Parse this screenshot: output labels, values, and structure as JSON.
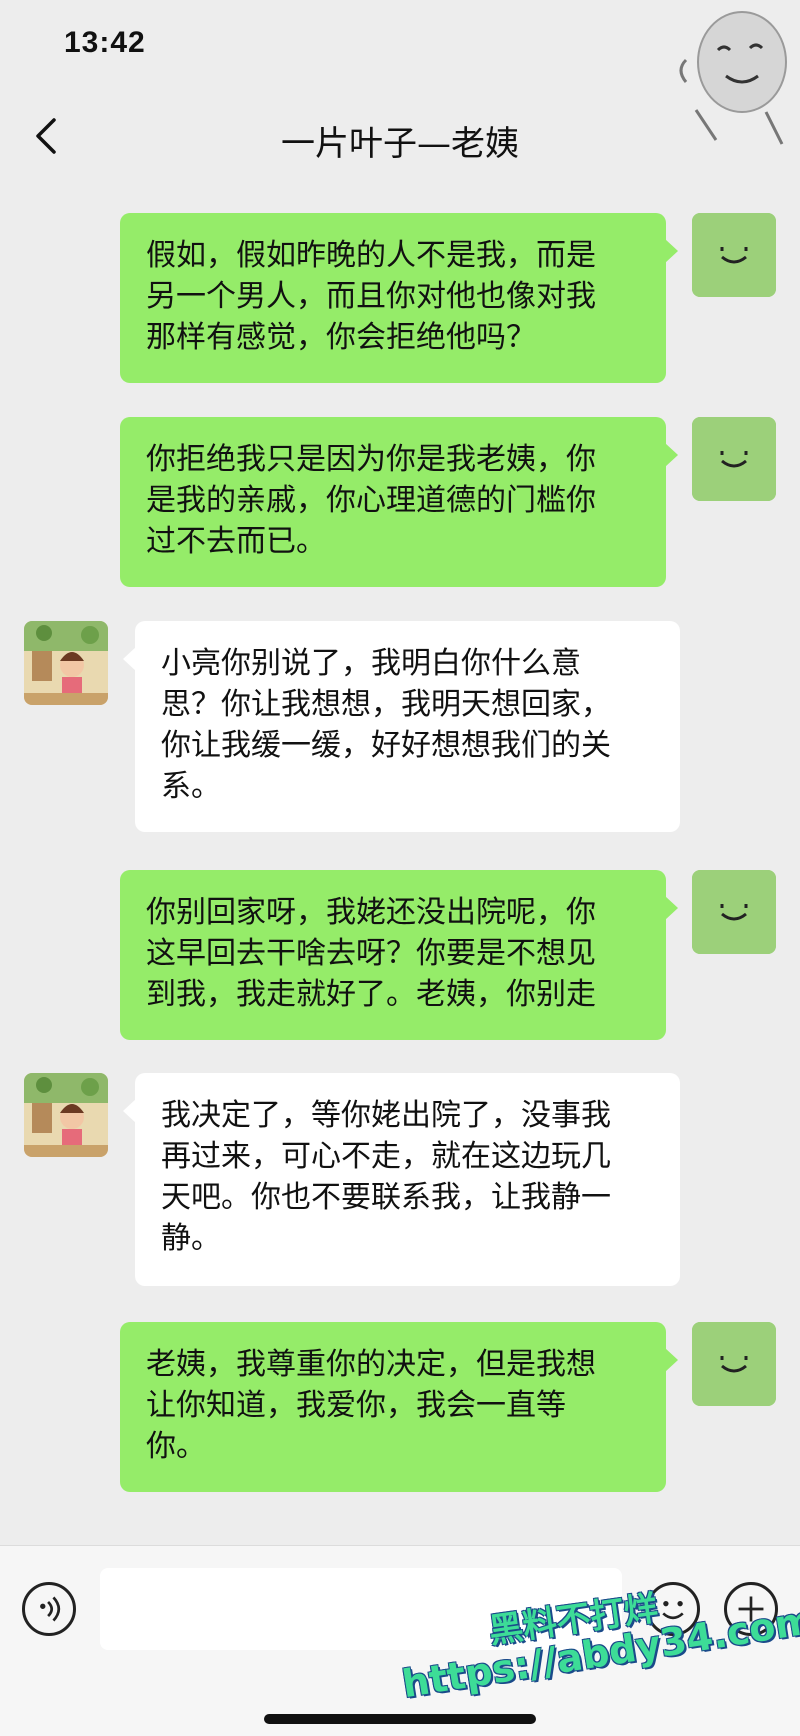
{
  "status_bar": {
    "time": "13:42"
  },
  "nav": {
    "title": "一片叶子—老姨"
  },
  "colors": {
    "me_bubble": "#95ec69",
    "other_bubble": "#ffffff",
    "background": "#ededed"
  },
  "messages": [
    {
      "sender": "me",
      "lines": [
        "假如，假如昨晚的人不是我，而是",
        "另一个男人，而且你对他也像对我",
        "那样有感觉，你会拒绝他吗？"
      ]
    },
    {
      "sender": "me",
      "lines": [
        "你拒绝我只是因为你是我老姨，你",
        "是我的亲戚，你心理道德的门槛你",
        "过不去而已。"
      ]
    },
    {
      "sender": "other",
      "lines": [
        "小亮你别说了，我明白你什么意",
        "思？你让我想想，我明天想回家，",
        "你让我缓一缓，好好想想我们的关",
        "系。"
      ]
    },
    {
      "sender": "me",
      "lines": [
        "你别回家呀，我姥还没出院呢，你",
        "这早回去干啥去呀？你要是不想见",
        "到我，我走就好了。老姨，你别走"
      ]
    },
    {
      "sender": "other",
      "lines": [
        "我决定了，等你姥出院了，没事我",
        "再过来，可心不走，就在这边玩几",
        "天吧。你也不要联系我，让我静一",
        "静。"
      ]
    },
    {
      "sender": "me",
      "lines": [
        "老姨，我尊重你的决定，但是我想",
        "让你知道，我爱你，我会一直等",
        "你。"
      ]
    }
  ],
  "bottom_bar": {
    "voice_icon": "voice-icon",
    "emoji_icon": "emoji-icon",
    "plus_icon": "plus-icon"
  },
  "watermark": {
    "line1": "黑料不打烊",
    "line2": "https://abdy34.com"
  }
}
